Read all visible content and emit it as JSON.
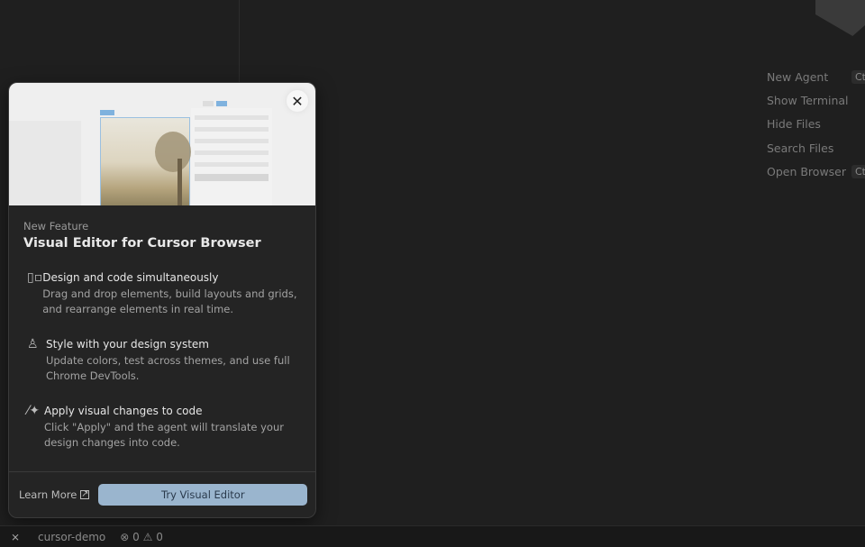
{
  "shortcuts": [
    {
      "label": "New Agent",
      "key": "Ct"
    },
    {
      "label": "Show Terminal"
    },
    {
      "label": "Hide Files"
    },
    {
      "label": "Search Files"
    },
    {
      "label": "Open Browser",
      "key": "Ct"
    }
  ],
  "dialog": {
    "kicker": "New Feature",
    "title": "Visual Editor for Cursor Browser",
    "features": [
      {
        "icon": "layout-icon",
        "title": "Design and code simultaneously",
        "desc": "Drag and drop elements, build layouts and grids, and rearrange elements in real time."
      },
      {
        "icon": "paint-bucket-icon",
        "title": "Style with your design system",
        "desc": "Update colors, test across themes, and use full Chrome DevTools."
      },
      {
        "icon": "magic-wand-icon",
        "title": "Apply visual changes to code",
        "desc": "Click \"Apply\" and the agent will translate your design changes into code."
      }
    ],
    "learn_more": "Learn More",
    "try_button": "Try Visual Editor",
    "close": "✕"
  },
  "status": {
    "project": "cursor-demo",
    "errors": "0",
    "warnings": "0"
  }
}
